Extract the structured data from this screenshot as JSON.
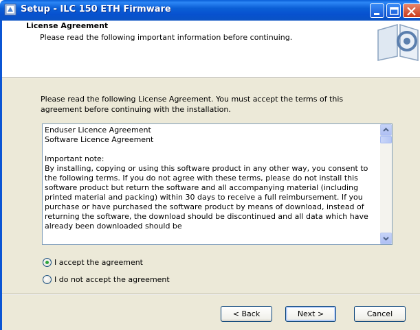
{
  "window": {
    "title": "Setup - ILC 150 ETH Firmware"
  },
  "header": {
    "title": "License Agreement",
    "subtitle": "Please read the following important information before continuing."
  },
  "body": {
    "intro": "Please read the following License Agreement. You must accept the terms of this agreement before continuing with the installation.",
    "license_text": "Enduser Licence Agreement\nSoftware Licence Agreement\n\nImportant note:\nBy installing, copying or using this software product in any other way, you consent to the following terms. If you do not agree with these terms, please do not install this software product but return the software and all accompanying material (including printed material and packing) within 30 days to receive a full reimbursement. If you purchase or have purchased the software product by means of download, instead of returning the software, the download should be discontinued and all data which have already been downloaded should be",
    "radio_accept": "I accept the agreement",
    "radio_decline": "I do not accept the agreement",
    "selected": "accept"
  },
  "buttons": {
    "back": "< Back",
    "next": "Next >",
    "cancel": "Cancel"
  },
  "icons": {
    "app": "setup-app-icon",
    "header_logo": "installer-logo-icon",
    "minimize": "minimize-icon",
    "maximize": "maximize-icon",
    "close": "close-icon"
  }
}
